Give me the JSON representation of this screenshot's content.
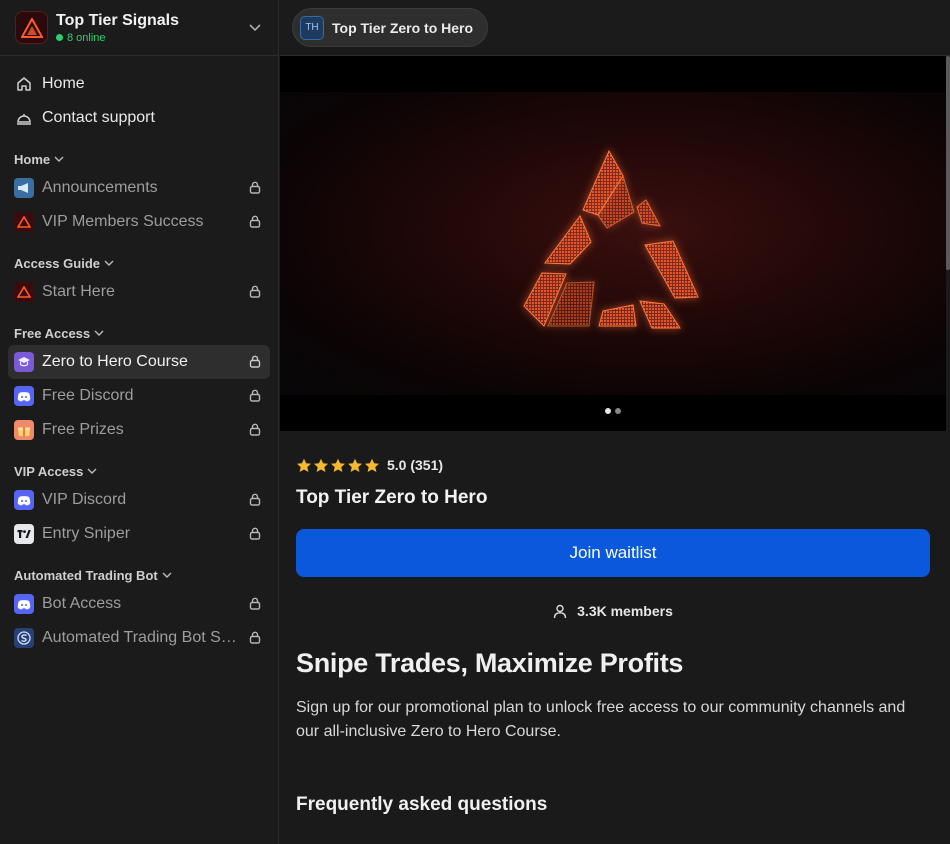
{
  "workspace": {
    "name": "Top Tier Signals",
    "online": "8 online",
    "online_color": "#2ecf70"
  },
  "nav": {
    "home": "Home",
    "support": "Contact support"
  },
  "sections": [
    {
      "label": "Home",
      "channels": [
        {
          "label": "Announcements",
          "icon": "megaphone-icon",
          "locked": true
        },
        {
          "label": "VIP Members Success",
          "icon": "brand-logo-icon",
          "locked": true
        }
      ]
    },
    {
      "label": "Access Guide",
      "channels": [
        {
          "label": "Start Here",
          "icon": "brand-logo-icon",
          "locked": true
        }
      ]
    },
    {
      "label": "Free Access",
      "channels": [
        {
          "label": "Zero to Hero Course",
          "icon": "graduation-cap-icon",
          "locked": true,
          "active": true
        },
        {
          "label": "Free Discord",
          "icon": "discord-icon",
          "locked": true
        },
        {
          "label": "Free Prizes",
          "icon": "gift-icon",
          "locked": true
        }
      ]
    },
    {
      "label": "VIP Access",
      "channels": [
        {
          "label": "VIP Discord",
          "icon": "discord-icon",
          "locked": true
        },
        {
          "label": "Entry Sniper",
          "icon": "tradingview-icon",
          "locked": true
        }
      ]
    },
    {
      "label": "Automated Trading Bot",
      "channels": [
        {
          "label": "Bot Access",
          "icon": "discord-icon",
          "locked": true
        },
        {
          "label": "Automated Trading Bot Setup",
          "icon": "bot-s-icon",
          "locked": true
        }
      ]
    }
  ],
  "topbar": {
    "avatar": "TH",
    "title": "Top Tier Zero to Hero"
  },
  "hero": {
    "slide_count": 2,
    "active_slide": 1
  },
  "product": {
    "rating": 5.0,
    "rating_text": "5.0 (351)",
    "title": "Top Tier Zero to Hero",
    "cta": "Join waitlist",
    "members": "3.3K members",
    "headline": "Snipe Trades, Maximize Profits",
    "description": "Sign up for our promotional plan to unlock free access to our community channels and our all-inclusive Zero to Hero Course.",
    "faq_title": "Frequently asked questions"
  },
  "colors": {
    "accent": "#0a58db",
    "star": "#f5b82e",
    "brand": "#ff5a2a"
  }
}
